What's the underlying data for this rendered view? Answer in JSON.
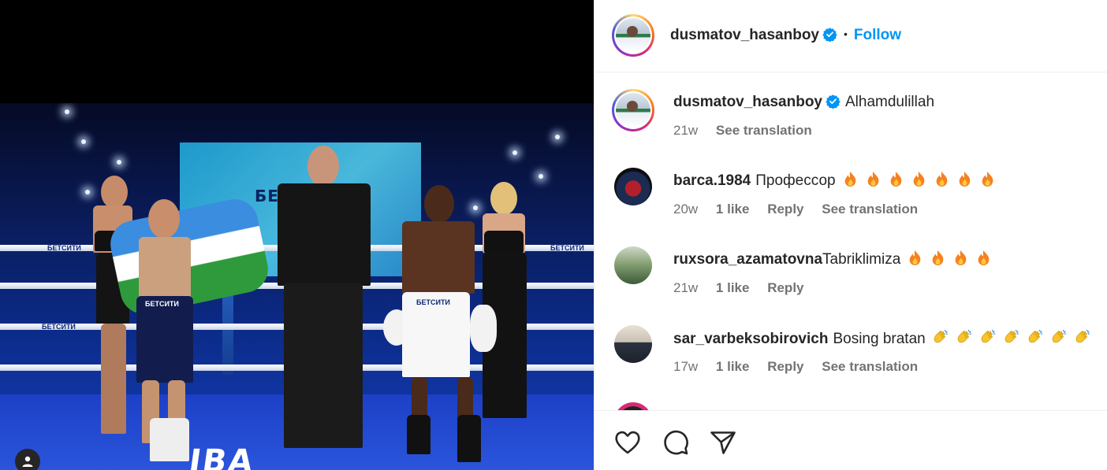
{
  "post": {
    "username": "dusmatov_hasanboy",
    "follow_label": "Follow",
    "separator": "•"
  },
  "photo": {
    "screen_mark": "БЕТСИТИ",
    "rope_text": "БЕТСИТИ",
    "floor_text": "IBA",
    "trunks_text": "БЕТСИТИ"
  },
  "caption": {
    "username": "dusmatov_hasanboy",
    "text": "Alhamdulillah",
    "time": "21w",
    "translate": "See translation"
  },
  "comments": [
    {
      "username": "barca.1984",
      "text": "Профессор",
      "emoji": "fire-emoji",
      "emoji_count": 7,
      "time": "20w",
      "likes": "1 like",
      "reply": "Reply",
      "translate": "See translation"
    },
    {
      "username": "ruxsora_azamatovna",
      "text": "Tabriklimiza",
      "emoji": "fire-emoji",
      "emoji_count": 4,
      "time": "21w",
      "likes": "1 like",
      "reply": "Reply",
      "translate": ""
    },
    {
      "username": "sar_varbeksobirovich",
      "text": "Bosing bratan",
      "emoji": "clapping-hands-emoji",
      "emoji_count": 7,
      "time": "17w",
      "likes": "1 like",
      "reply": "Reply",
      "translate": "See translation"
    }
  ],
  "colors": {
    "accent": "#0095f6",
    "muted": "#737373",
    "text": "#262626",
    "border": "#efefef"
  },
  "icons": [
    "verified-badge-icon",
    "heart-icon",
    "comment-icon",
    "share-icon",
    "user-tag-icon"
  ]
}
